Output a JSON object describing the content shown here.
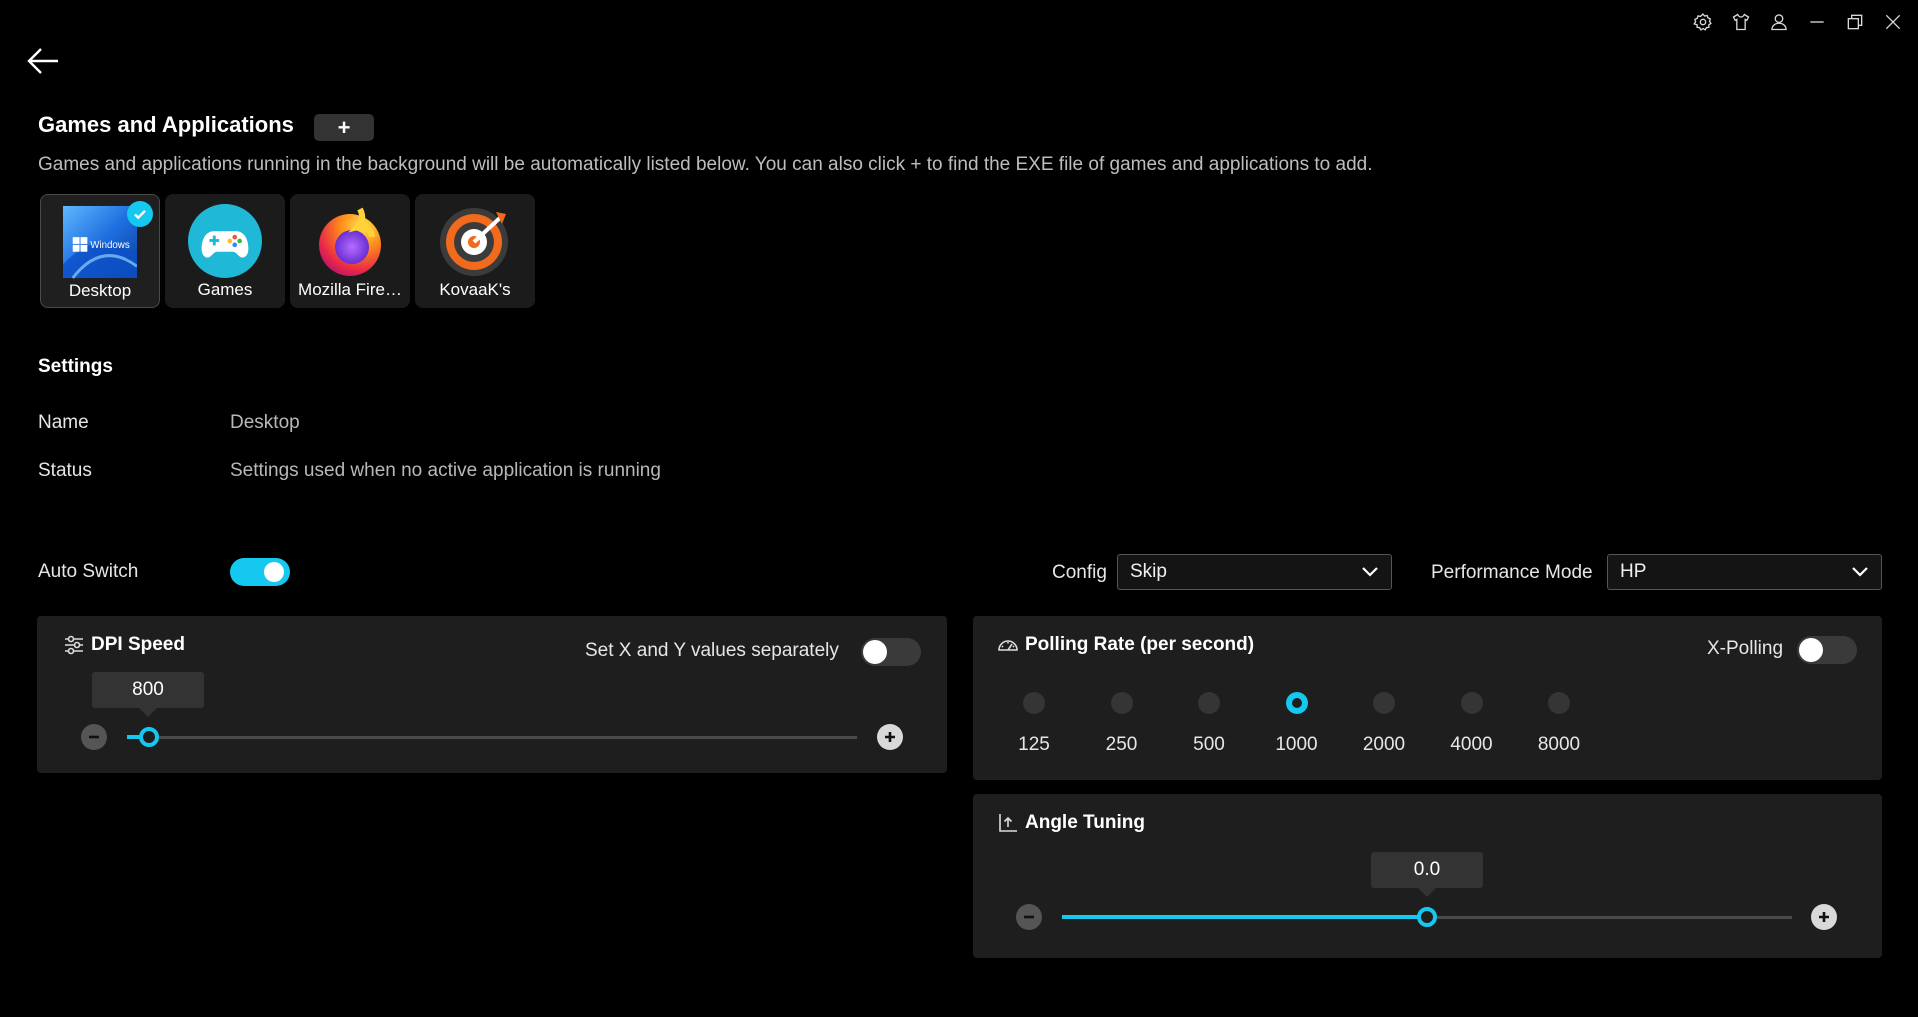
{
  "header": {
    "icons": [
      "gear-icon",
      "shirt-icon",
      "user-icon",
      "minimize-icon",
      "restore-icon",
      "close-icon"
    ]
  },
  "apps_section": {
    "title": "Games and Applications",
    "add_label": "+",
    "description": "Games and applications running in the background will be automatically listed below. You can also click + to find the EXE file of games and applications to add.",
    "apps": [
      {
        "label": "Desktop",
        "icon": "windows-desktop-icon",
        "selected": true,
        "icon_text": "Windows"
      },
      {
        "label": "Games",
        "icon": "gamepad-icon",
        "selected": false
      },
      {
        "label": "Mozilla Fire…",
        "icon": "firefox-icon",
        "selected": false
      },
      {
        "label": "KovaaK's",
        "icon": "kovaaks-target-icon",
        "selected": false
      }
    ]
  },
  "settings": {
    "title": "Settings",
    "name_label": "Name",
    "name_value": "Desktop",
    "status_label": "Status",
    "status_value": "Settings used when no active application is running"
  },
  "controls": {
    "auto_switch_label": "Auto Switch",
    "auto_switch_on": true,
    "config_label": "Config",
    "config_value": "Skip",
    "performance_label": "Performance Mode",
    "performance_value": "HP"
  },
  "dpi": {
    "title": "DPI Speed",
    "separate_label": "Set X and Y values separately",
    "separate_on": false,
    "value": "800",
    "slider_fraction": 0.03
  },
  "polling": {
    "title": "Polling Rate (per second)",
    "xpolling_label": "X-Polling",
    "xpolling_on": false,
    "options": [
      "125",
      "250",
      "500",
      "1000",
      "2000",
      "4000",
      "8000"
    ],
    "selected": "1000"
  },
  "angle": {
    "title": "Angle Tuning",
    "value": "0.0",
    "slider_fraction": 0.5
  },
  "colors": {
    "accent": "#14c8ef",
    "panel": "#1e1e1e",
    "background": "#000000"
  }
}
